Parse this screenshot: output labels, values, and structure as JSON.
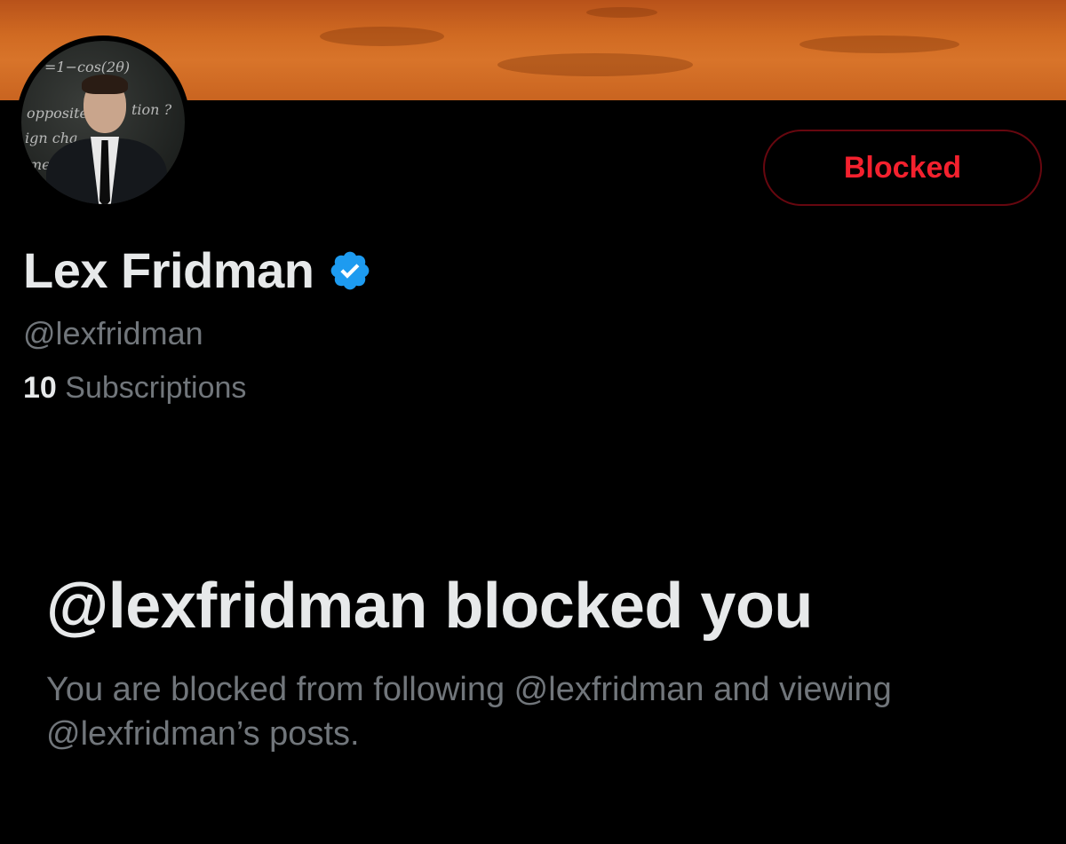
{
  "profile": {
    "display_name": "Lex Fridman",
    "handle": "@lexfridman",
    "verified": true,
    "subscriptions_count": "10",
    "subscriptions_label": "Subscriptions"
  },
  "avatar": {
    "chalk_lines": [
      "=1−cos(2θ)",
      "opposite",
      "tion ?",
      "ign cha",
      "me"
    ]
  },
  "actions": {
    "blocked_label": "Blocked"
  },
  "block_notice": {
    "title": "@lexfridman blocked you",
    "description": "You are blocked from following @lexfridman and viewing @lexfridman’s posts."
  },
  "colors": {
    "background": "#000000",
    "primary_text": "#e7e9ea",
    "secondary_text": "#71767b",
    "blocked_red": "#f4212e",
    "blocked_border": "#67070f",
    "verified_blue": "#1d9bf0",
    "banner_orange": "#d06a22"
  },
  "icons": {
    "verified": "verified-badge-icon"
  }
}
